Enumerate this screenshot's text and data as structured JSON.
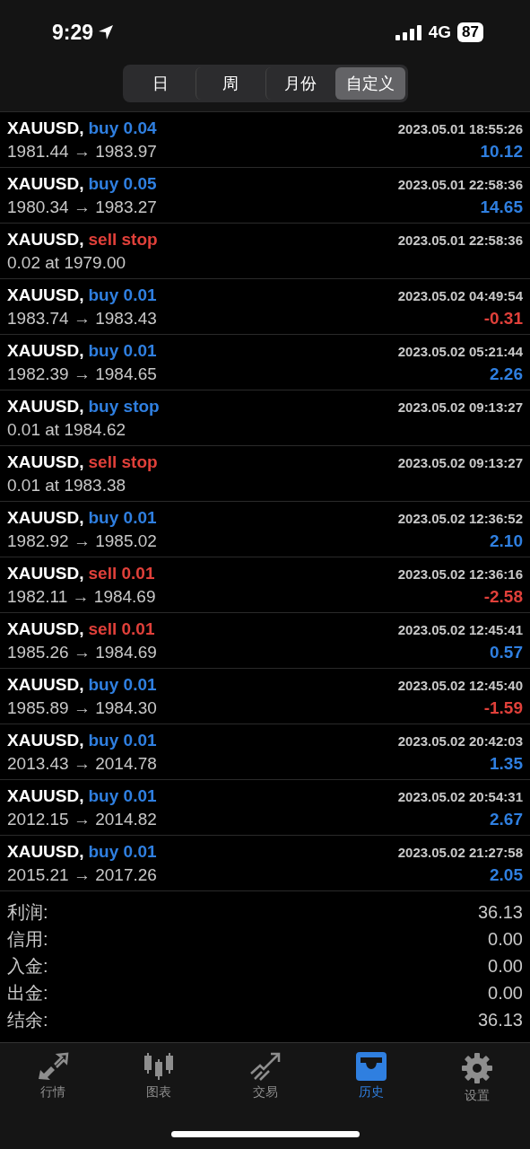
{
  "status_bar": {
    "time": "9:29",
    "network": "4G",
    "battery": "87"
  },
  "tabs": [
    {
      "label": "日",
      "selected": false
    },
    {
      "label": "周",
      "selected": false
    },
    {
      "label": "月份",
      "selected": false
    },
    {
      "label": "自定义",
      "selected": true
    }
  ],
  "deals": [
    {
      "symbol": "XAUUSD,",
      "action": "buy 0.04",
      "kind": "buy",
      "time": "2023.05.01 18:55:26",
      "prices": "1981.44 → 1983.97",
      "profit": "10.12",
      "loss": false
    },
    {
      "symbol": "XAUUSD,",
      "action": "buy 0.05",
      "kind": "buy",
      "time": "2023.05.01 22:58:36",
      "prices": "1980.34 → 1983.27",
      "profit": "14.65",
      "loss": false
    },
    {
      "symbol": "XAUUSD,",
      "action": "sell stop",
      "kind": "sell",
      "time": "2023.05.01 22:58:36",
      "prices": "0.02 at 1979.00"
    },
    {
      "symbol": "XAUUSD,",
      "action": "buy 0.01",
      "kind": "buy",
      "time": "2023.05.02 04:49:54",
      "prices": "1983.74 → 1983.43",
      "profit": "-0.31",
      "loss": true
    },
    {
      "symbol": "XAUUSD,",
      "action": "buy 0.01",
      "kind": "buy",
      "time": "2023.05.02 05:21:44",
      "prices": "1982.39 → 1984.65",
      "profit": "2.26",
      "loss": false
    },
    {
      "symbol": "XAUUSD,",
      "action": "buy stop",
      "kind": "buy",
      "time": "2023.05.02 09:13:27",
      "prices": "0.01 at 1984.62"
    },
    {
      "symbol": "XAUUSD,",
      "action": "sell stop",
      "kind": "sell",
      "time": "2023.05.02 09:13:27",
      "prices": "0.01 at 1983.38"
    },
    {
      "symbol": "XAUUSD,",
      "action": "buy 0.01",
      "kind": "buy",
      "time": "2023.05.02 12:36:52",
      "prices": "1982.92 → 1985.02",
      "profit": "2.10",
      "loss": false
    },
    {
      "symbol": "XAUUSD,",
      "action": "sell 0.01",
      "kind": "sell",
      "time": "2023.05.02 12:36:16",
      "prices": "1982.11 → 1984.69",
      "profit": "-2.58",
      "loss": true
    },
    {
      "symbol": "XAUUSD,",
      "action": "sell 0.01",
      "kind": "sell",
      "time": "2023.05.02 12:45:41",
      "prices": "1985.26 → 1984.69",
      "profit": "0.57",
      "loss": false
    },
    {
      "symbol": "XAUUSD,",
      "action": "buy 0.01",
      "kind": "buy",
      "time": "2023.05.02 12:45:40",
      "prices": "1985.89 → 1984.30",
      "profit": "-1.59",
      "loss": true
    },
    {
      "symbol": "XAUUSD,",
      "action": "buy 0.01",
      "kind": "buy",
      "time": "2023.05.02 20:42:03",
      "prices": "2013.43 → 2014.78",
      "profit": "1.35",
      "loss": false
    },
    {
      "symbol": "XAUUSD,",
      "action": "buy 0.01",
      "kind": "buy",
      "time": "2023.05.02 20:54:31",
      "prices": "2012.15 → 2014.82",
      "profit": "2.67",
      "loss": false
    },
    {
      "symbol": "XAUUSD,",
      "action": "buy 0.01",
      "kind": "buy",
      "time": "2023.05.02 21:27:58",
      "prices": "2015.21 → 2017.26",
      "profit": "2.05",
      "loss": false
    }
  ],
  "summary": [
    {
      "label": "利润:",
      "value": "36.13"
    },
    {
      "label": "信用:",
      "value": "0.00"
    },
    {
      "label": "入金:",
      "value": "0.00"
    },
    {
      "label": "出金:",
      "value": "0.00"
    },
    {
      "label": "结余:",
      "value": "36.13"
    }
  ],
  "nav": [
    {
      "label": "行情",
      "kind": "arrows",
      "selected": false
    },
    {
      "label": "图表",
      "kind": "candles",
      "selected": false
    },
    {
      "label": "交易",
      "kind": "trend",
      "selected": false
    },
    {
      "label": "历史",
      "kind": "inbox",
      "selected": true
    },
    {
      "label": "设置",
      "kind": "gear",
      "selected": false
    }
  ]
}
